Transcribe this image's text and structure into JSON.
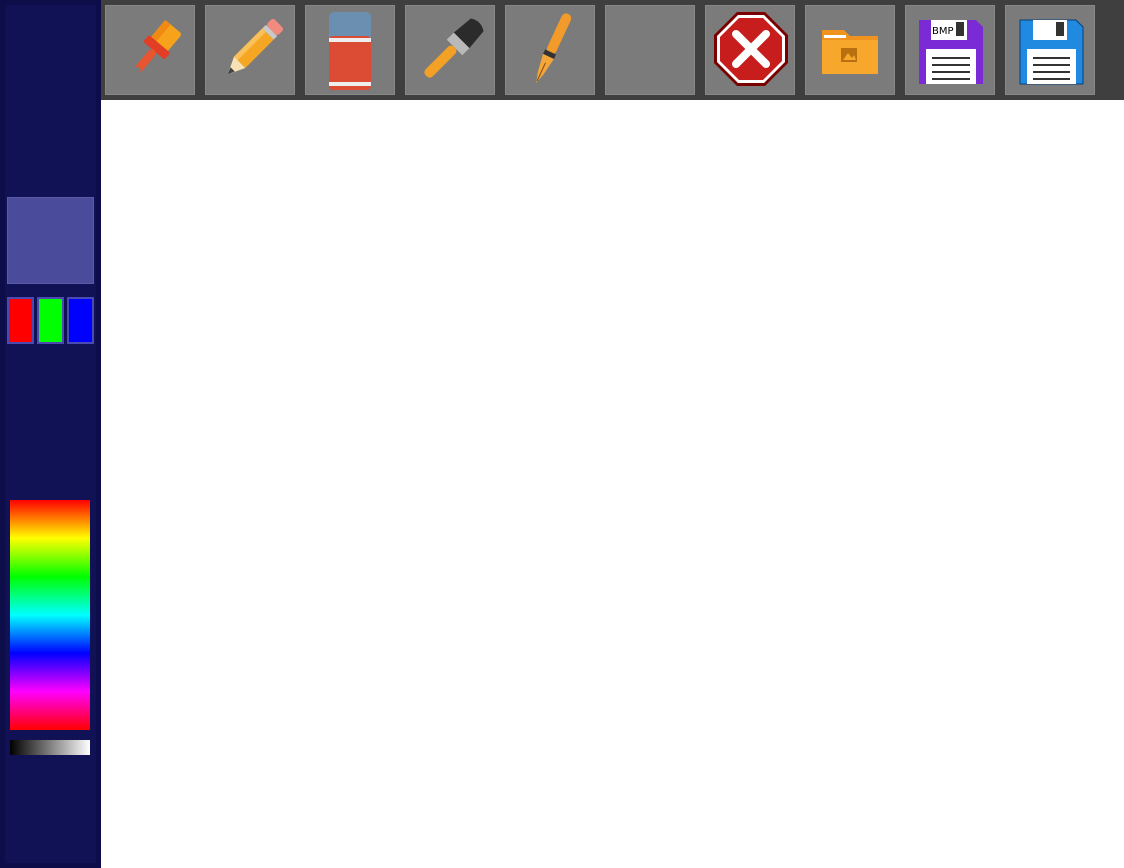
{
  "colors": {
    "current": "#4b4b9b",
    "red_channel": "#ff0000",
    "green_channel": "#00ff00",
    "blue_channel": "#0000ff",
    "panel_bg": "#111155",
    "toolbar_bg": "#3f3f3f",
    "tool_bg": "#7b7b7b",
    "canvas_bg": "#ffffff"
  },
  "toolbar": {
    "tools": [
      {
        "name": "paintbrush",
        "icon": "paint-roller-brush-icon"
      },
      {
        "name": "pencil",
        "icon": "pencil-icon"
      },
      {
        "name": "eraser",
        "icon": "eraser-icon"
      },
      {
        "name": "brush",
        "icon": "brush-icon"
      },
      {
        "name": "pen",
        "icon": "fountain-pen-icon"
      },
      {
        "name": "empty",
        "icon": ""
      },
      {
        "name": "clear",
        "icon": "close-octagon-icon"
      },
      {
        "name": "open",
        "icon": "folder-image-icon"
      },
      {
        "name": "save-bmp",
        "icon": "floppy-bmp-icon",
        "label": "BMP"
      },
      {
        "name": "save",
        "icon": "floppy-icon"
      }
    ]
  }
}
